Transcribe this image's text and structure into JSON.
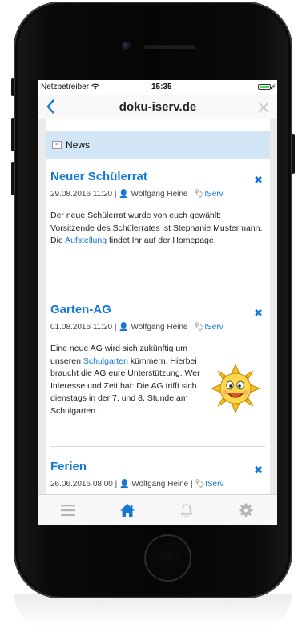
{
  "status": {
    "carrier": "Netzbetreiber",
    "time": "15:35",
    "wifi_icon": "wifi-icon",
    "battery_icon": "battery-icon"
  },
  "navbar": {
    "title": "doku-iserv.de",
    "back_icon": "chevron-left-icon",
    "close_icon": "close-icon"
  },
  "section": {
    "label": "News",
    "icon": "news-icon"
  },
  "posts": [
    {
      "title": "Neuer Schülerrat",
      "date": "29.08.2016 11:20",
      "author": "Wolfgang Heine",
      "tag": "IServ",
      "text_before": "Der neue Schülerrat wurde von euch gewählt: Vorsitzende des Schülerrates ist Stephanie Mustermann. Die ",
      "link": "Aufstellung",
      "text_after": " findet Ihr auf der Homepage."
    },
    {
      "title": "Garten-AG",
      "date": "01.08.2016 11:20",
      "author": "Wolfgang Heine",
      "tag": "IServ",
      "text_before": "Eine neue AG wird sich zukünftig um unseren ",
      "link": "Schulgarten",
      "text_after": " kümmern. Hierbei braucht die AG eure Unterstützung. Wer Interesse und Zeit hat: Die AG trifft sich dienstags in der 7. und 8. Stunde am Schulgarten.",
      "image": "smiling-sun-image"
    },
    {
      "title": "Ferien",
      "date": "26.06.2016 08:00",
      "author": "Wolfgang Heine",
      "tag": "IServ"
    }
  ],
  "tabbar": {
    "items": [
      "menu-icon",
      "home-icon",
      "bell-icon",
      "gear-icon"
    ],
    "active_index": 1,
    "active_color": "#1478d4",
    "inactive_color": "#b5b5b5"
  },
  "colors": {
    "accent": "#1478d4",
    "news_header": "#d3e6f6"
  }
}
